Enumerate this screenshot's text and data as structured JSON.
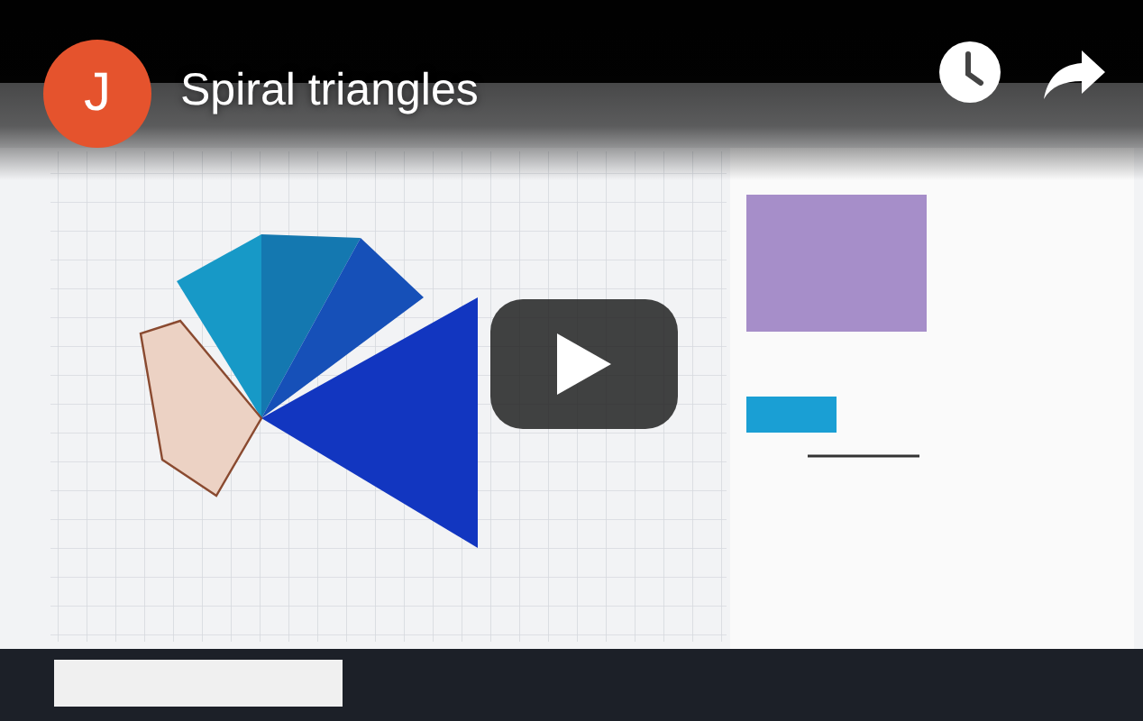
{
  "video": {
    "channel_initial": "J",
    "title": "Spiral triangles"
  }
}
